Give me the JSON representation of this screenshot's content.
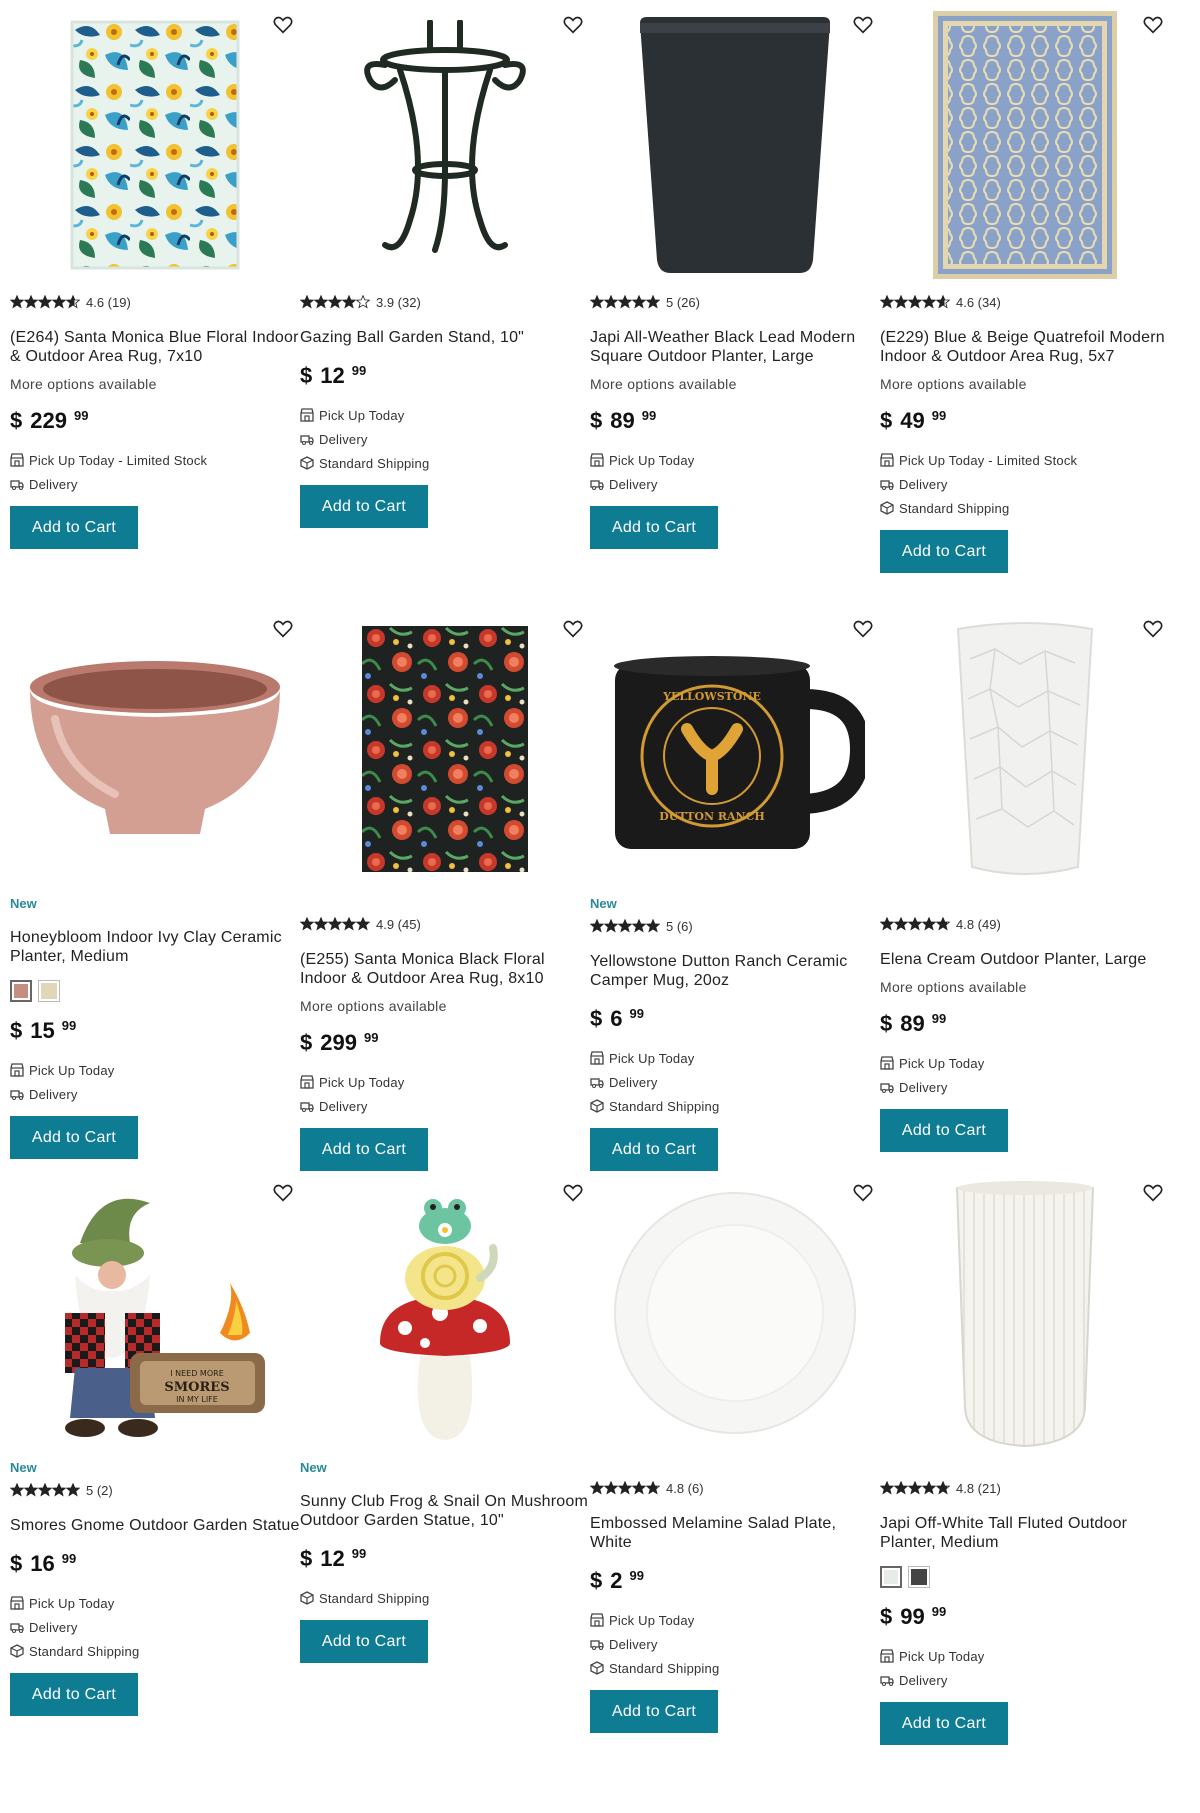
{
  "colors": {
    "accent": "#0e7c93",
    "new_badge": "#2a8a9a"
  },
  "products": [
    {
      "title": "(E264) Santa Monica Blue Floral Indoor & Outdoor Area Rug, 7x10",
      "rating": 4.6,
      "rating_text": "4.6 (19)",
      "more_options": "More options available",
      "price_dollars": "229",
      "price_cents": "99",
      "fulfillment": [
        "Pick Up Today - Limited Stock",
        "Delivery"
      ],
      "button": "Add to Cart",
      "image": "blue-floral-rug"
    },
    {
      "title": "Gazing Ball Garden Stand, 10\"",
      "rating": 3.9,
      "rating_text": "3.9 (32)",
      "price_dollars": "12",
      "price_cents": "99",
      "fulfillment": [
        "Pick Up Today",
        "Delivery",
        "Standard Shipping"
      ],
      "button": "Add to Cart",
      "image": "iron-garden-stand"
    },
    {
      "title": "Japi All-Weather Black Lead Modern Square Outdoor Planter, Large",
      "rating": 5,
      "rating_text": "5 (26)",
      "more_options": "More options available",
      "price_dollars": "89",
      "price_cents": "99",
      "fulfillment": [
        "Pick Up Today",
        "Delivery"
      ],
      "button": "Add to Cart",
      "image": "black-square-planter"
    },
    {
      "title": "(E229) Blue & Beige Quatrefoil Modern Indoor & Outdoor Area Rug, 5x7",
      "rating": 4.6,
      "rating_text": "4.6 (34)",
      "more_options": "More options available",
      "price_dollars": "49",
      "price_cents": "99",
      "fulfillment": [
        "Pick Up Today - Limited Stock",
        "Delivery",
        "Standard Shipping"
      ],
      "button": "Add to Cart",
      "image": "quatrefoil-rug"
    },
    {
      "badge": "New",
      "title": "Honeybloom Indoor Ivy Clay Ceramic Planter, Medium",
      "swatches": [
        "#c48e80",
        "#e2d6b8"
      ],
      "price_dollars": "15",
      "price_cents": "99",
      "fulfillment": [
        "Pick Up Today",
        "Delivery"
      ],
      "button": "Add to Cart",
      "image": "clay-planter"
    },
    {
      "title": "(E255) Santa Monica Black Floral Indoor & Outdoor Area Rug, 8x10",
      "rating": 4.9,
      "rating_text": "4.9 (45)",
      "more_options": "More options available",
      "price_dollars": "299",
      "price_cents": "99",
      "fulfillment": [
        "Pick Up Today",
        "Delivery"
      ],
      "button": "Add to Cart",
      "image": "black-floral-rug"
    },
    {
      "badge": "New",
      "title": "Yellowstone Dutton Ranch Ceramic Camper Mug, 20oz",
      "rating": 5,
      "rating_text": "5 (6)",
      "price_dollars": "6",
      "price_cents": "99",
      "fulfillment": [
        "Pick Up Today",
        "Delivery",
        "Standard Shipping"
      ],
      "button": "Add to Cart",
      "image": "yellowstone-mug",
      "mug_text_top": "YELLOWSTONE",
      "mug_text_bottom": "DUTTON RANCH"
    },
    {
      "title": "Elena Cream Outdoor Planter, Large",
      "rating": 4.8,
      "rating_text": "4.8 (49)",
      "more_options": "More options available",
      "price_dollars": "89",
      "price_cents": "99",
      "fulfillment": [
        "Pick Up Today",
        "Delivery"
      ],
      "button": "Add to Cart",
      "image": "white-faceted-planter"
    },
    {
      "badge": "New",
      "title": "Smores Gnome Outdoor Garden Statue",
      "rating": 5,
      "rating_text": "5 (2)",
      "price_dollars": "16",
      "price_cents": "99",
      "fulfillment": [
        "Pick Up Today",
        "Delivery",
        "Standard Shipping"
      ],
      "button": "Add to Cart",
      "image": "smores-gnome",
      "sign_lines": [
        "I NEED MORE",
        "SMORES",
        "IN MY LIFE"
      ]
    },
    {
      "badge": "New",
      "title": "Sunny Club Frog & Snail On Mushroom Outdoor Garden Statue, 10\"",
      "price_dollars": "12",
      "price_cents": "99",
      "fulfillment": [
        "Standard Shipping"
      ],
      "button": "Add to Cart",
      "image": "frog-snail-mushroom"
    },
    {
      "title": "Embossed Melamine Salad Plate, White",
      "rating": 4.8,
      "rating_text": "4.8 (6)",
      "price_dollars": "2",
      "price_cents": "99",
      "fulfillment": [
        "Pick Up Today",
        "Delivery",
        "Standard Shipping"
      ],
      "button": "Add to Cart",
      "image": "white-plate"
    },
    {
      "title": "Japi Off-White Tall Fluted Outdoor Planter, Medium",
      "rating": 4.8,
      "rating_text": "4.8 (21)",
      "swatches": [
        "#e8ece8",
        "#444444"
      ],
      "price_dollars": "99",
      "price_cents": "99",
      "fulfillment": [
        "Pick Up Today",
        "Delivery"
      ],
      "button": "Add to Cart",
      "image": "fluted-planter"
    }
  ]
}
